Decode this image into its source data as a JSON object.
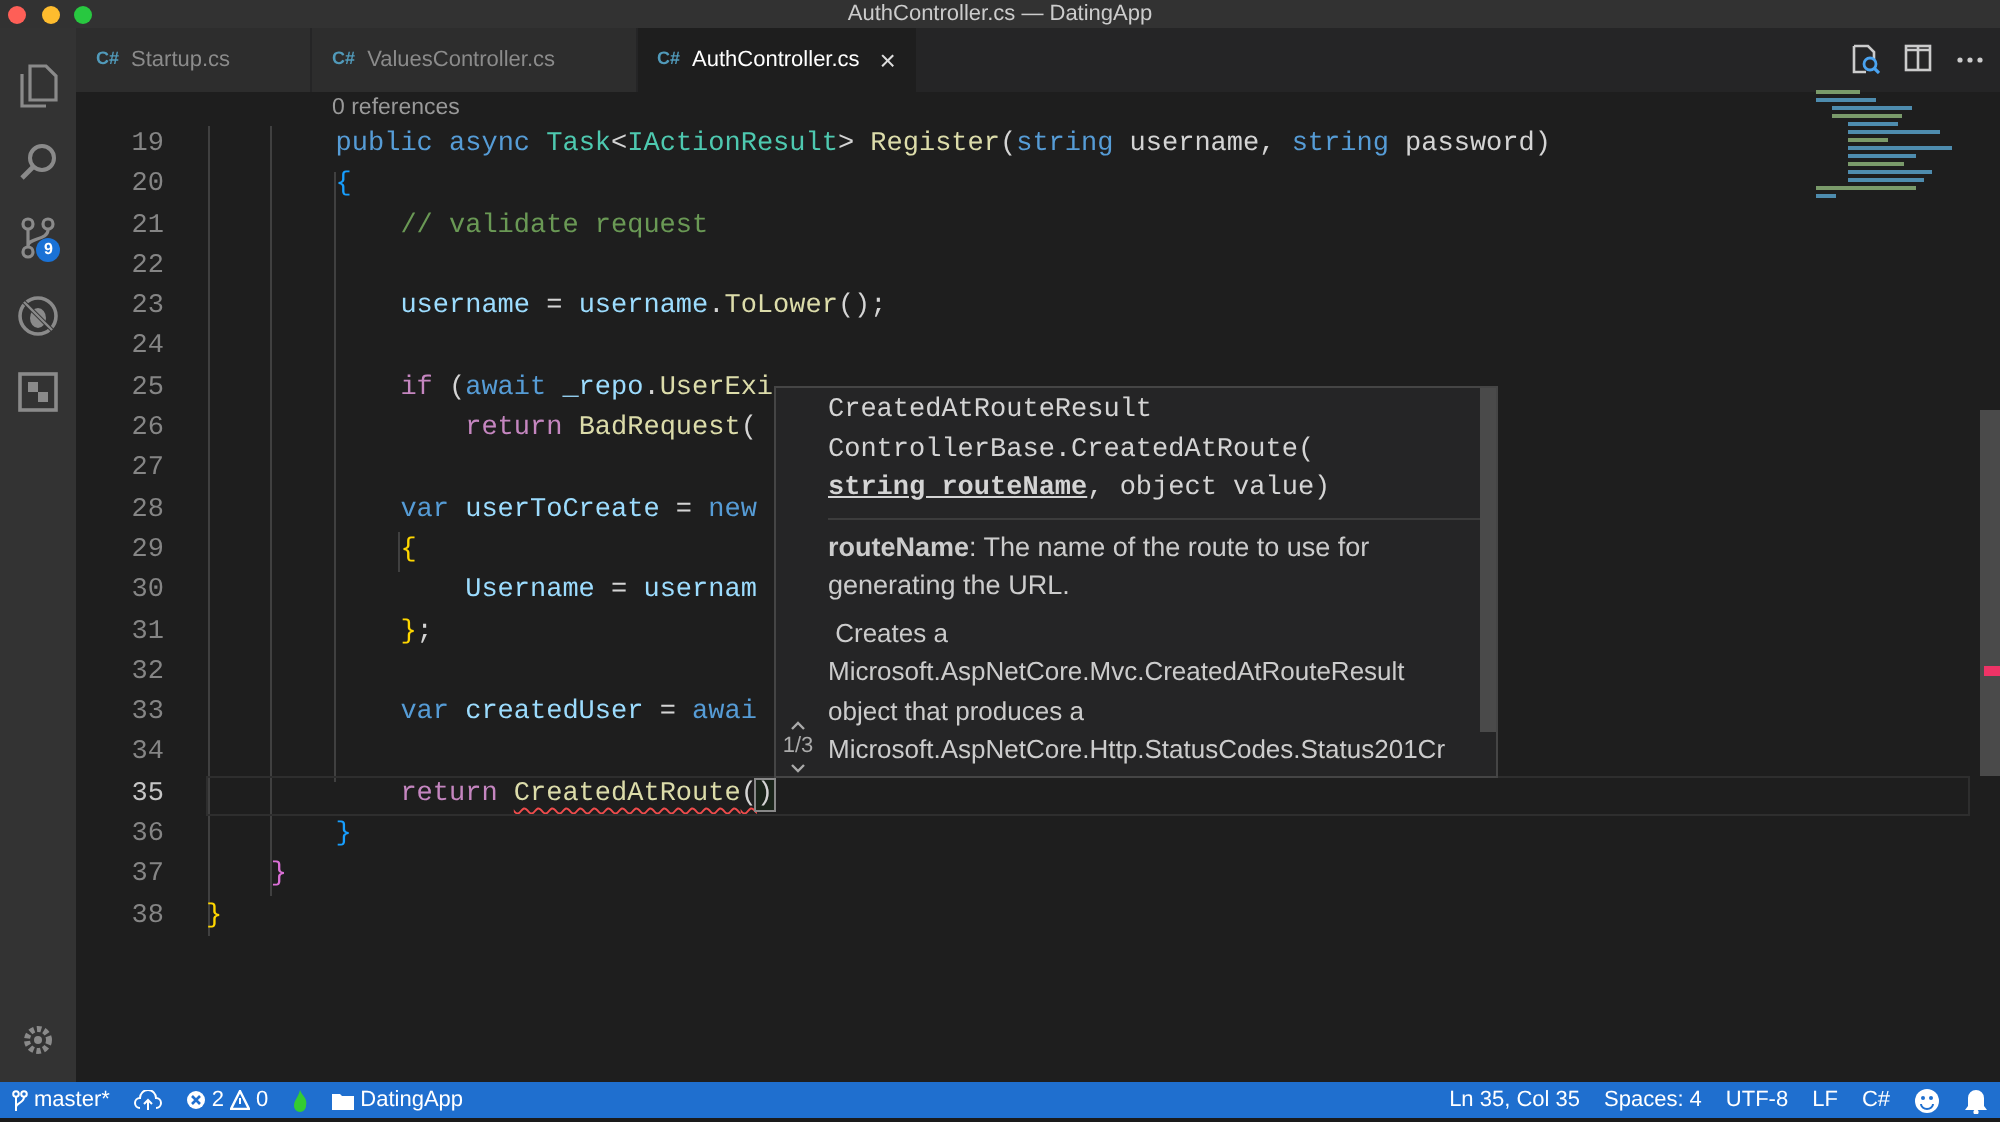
{
  "window": {
    "title": "AuthController.cs — DatingApp"
  },
  "activity_bar": {
    "source_control_badge": "9"
  },
  "tabs": [
    {
      "icon_label": "C#",
      "label": "Startup.cs",
      "selected": false
    },
    {
      "icon_label": "C#",
      "label": "ValuesController.cs",
      "selected": false
    },
    {
      "icon_label": "C#",
      "label": "AuthController.cs",
      "selected": true,
      "close_label": "×"
    }
  ],
  "editor": {
    "codelens": "0 references",
    "lines": [
      {
        "children": [
          {
            "children": [
              {
                "number": "19",
                "current": false,
                "segments": [
                  {
                    "text": "public ",
                    "kind": "keyword"
                  },
                  {
                    "text": "async ",
                    "kind": "keyword"
                  },
                  {
                    "text": "Task",
                    "kind": "type"
                  },
                  {
                    "text": "<",
                    "kind": "plain"
                  },
                  {
                    "text": "IActionResult",
                    "kind": "type"
                  },
                  {
                    "text": "> ",
                    "kind": "plain"
                  },
                  {
                    "text": "Register",
                    "kind": "function"
                  },
                  {
                    "text": "(",
                    "kind": "plain"
                  },
                  {
                    "text": "string",
                    "kind": "keyword"
                  },
                  {
                    "text": " username, ",
                    "kind": "plain"
                  },
                  {
                    "text": "string",
                    "kind": "keyword"
                  },
                  {
                    "text": " password)",
                    "kind": "plain"
                  }
                ]
              },
              {
                "number": "20",
                "current": false,
                "segments": [
                  {
                    "text": "{",
                    "kind": "bracket_blue"
                  }
                ]
              },
              {
                "children": [
                  {
                    "number": "21",
                    "current": false,
                    "segments": [
                      {
                        "text": "// validate request",
                        "kind": "comment"
                      }
                    ]
                  },
                  {
                    "number": "22",
                    "current": false
                  },
                  {
                    "number": "23",
                    "current": false,
                    "segments": [
                      {
                        "text": "username",
                        "kind": "variable"
                      },
                      {
                        "text": " = ",
                        "kind": "plain"
                      },
                      {
                        "text": "username",
                        "kind": "variable"
                      },
                      {
                        "text": ".",
                        "kind": "plain"
                      },
                      {
                        "text": "ToLower",
                        "kind": "function"
                      },
                      {
                        "text": "();",
                        "kind": "plain"
                      }
                    ]
                  },
                  {
                    "number": "24",
                    "current": false
                  },
                  {
                    "number": "25",
                    "current": false,
                    "segments": [
                      {
                        "text": "if",
                        "kind": "control"
                      },
                      {
                        "text": " (",
                        "kind": "plain"
                      },
                      {
                        "text": "await ",
                        "kind": "keyword"
                      },
                      {
                        "text": "_repo",
                        "kind": "variable"
                      },
                      {
                        "text": ".",
                        "kind": "plain"
                      },
                      {
                        "text": "UserExi",
                        "kind": "function"
                      }
                    ],
                    "children": [
                      {
                        "number": "26",
                        "current": false,
                        "segments": [
                          {
                            "text": "return ",
                            "kind": "control"
                          },
                          {
                            "text": "BadRequest",
                            "kind": "function"
                          },
                          {
                            "text": "(",
                            "kind": "plain"
                          }
                        ]
                      }
                    ]
                  },
                  {
                    "number": "27",
                    "current": false
                  },
                  {
                    "number": "28",
                    "current": false,
                    "segments": [
                      {
                        "text": "var ",
                        "kind": "keyword"
                      },
                      {
                        "text": "userToCreate",
                        "kind": "variable"
                      },
                      {
                        "text": " = ",
                        "kind": "plain"
                      },
                      {
                        "text": "new",
                        "kind": "keyword"
                      }
                    ]
                  },
                  {
                    "number": "29",
                    "current": false,
                    "segments": [
                      {
                        "text": "{",
                        "kind": "bracket_gold"
                      }
                    ],
                    "children": [
                      {
                        "number": "30",
                        "current": false,
                        "segments": [
                          {
                            "text": "Username",
                            "kind": "variable"
                          },
                          {
                            "text": " = ",
                            "kind": "plain"
                          },
                          {
                            "text": "usernam",
                            "kind": "variable"
                          }
                        ]
                      }
                    ]
                  },
                  {
                    "number": "31",
                    "current": false,
                    "segments": [
                      {
                        "text": "}",
                        "kind": "bracket_gold"
                      },
                      {
                        "text": ";",
                        "kind": "plain"
                      }
                    ]
                  },
                  {
                    "number": "32",
                    "current": false
                  },
                  {
                    "number": "33",
                    "current": false,
                    "segments": [
                      {
                        "text": "var ",
                        "kind": "keyword"
                      },
                      {
                        "text": "createdUser",
                        "kind": "variable"
                      },
                      {
                        "text": " = ",
                        "kind": "plain"
                      },
                      {
                        "text": "awai",
                        "kind": "keyword"
                      }
                    ]
                  },
                  {
                    "number": "34",
                    "current": false
                  },
                  {
                    "number": "35",
                    "current": true,
                    "segments": [
                      {
                        "text": "return ",
                        "kind": "control"
                      },
                      {
                        "text": "CreatedAtRoute",
                        "kind": "function",
                        "squiggle": true
                      },
                      {
                        "text": "(",
                        "kind": "plain",
                        "squiggle": true
                      },
                      {
                        "text": ")",
                        "kind": "plain",
                        "bracket_match": true
                      }
                    ]
                  }
                ]
              },
              {
                "number": "36",
                "current": false,
                "segments": [
                  {
                    "text": "}",
                    "kind": "bracket_blue"
                  }
                ]
              }
            ]
          },
          {
            "number": "37",
            "current": false,
            "segments": [
              {
                "text": "}",
                "kind": "bracket_pink"
              }
            ]
          }
        ]
      },
      {
        "number": "38",
        "current": false,
        "segments": [
          {
            "text": "}",
            "kind": "bracket_gold"
          }
        ]
      }
    ],
    "hover": {
      "return_type": "CreatedAtRouteResult",
      "call": "ControllerBase.CreatedAtRoute(",
      "active_parameter": "string routeName",
      "rest": ", object value)",
      "parameter_doc": "**routeName**: The name of the route to use for generating the URL.",
      "description_lines": [
        "Creates a",
        "Microsoft.AspNetCore.Mvc.CreatedAtRouteResult",
        "object that produces a",
        "Microsoft.AspNetCore.Http.StatusCodes.Status201Cr"
      ],
      "overload": "1/3"
    }
  },
  "status_bar": {
    "branch": "master*",
    "errors": "2",
    "warnings": "0",
    "folder": "DatingApp",
    "position": "Ln 35, Col 35",
    "indentation": "Spaces: 4",
    "encoding": "UTF-8",
    "eol": "LF",
    "language": "C#"
  }
}
